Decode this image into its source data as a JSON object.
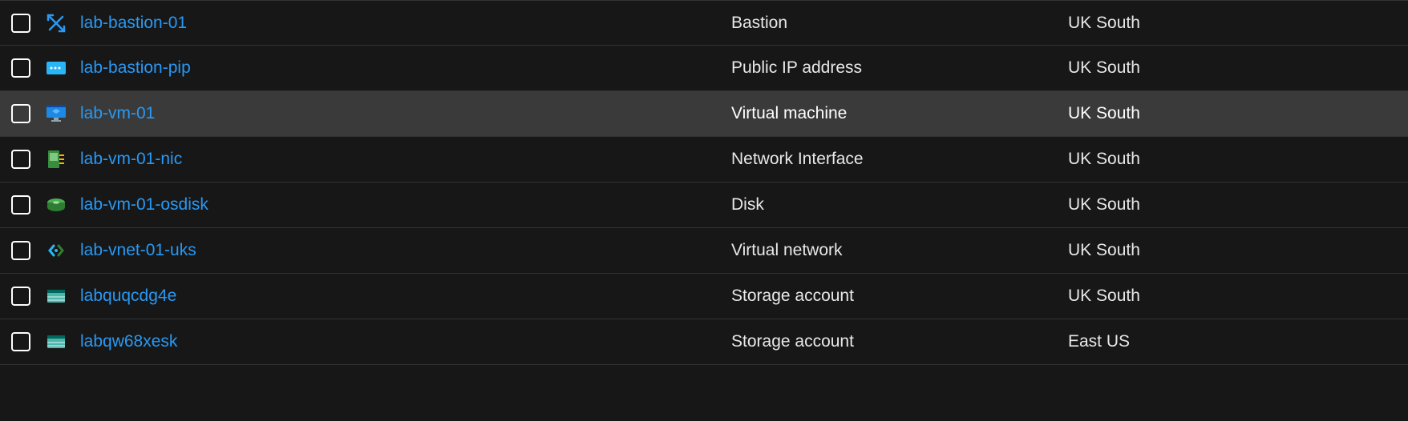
{
  "resources": [
    {
      "name": "lab-bastion-01",
      "type": "Bastion",
      "location": "UK South",
      "icon": "bastion",
      "hover": false
    },
    {
      "name": "lab-bastion-pip",
      "type": "Public IP address",
      "location": "UK South",
      "icon": "pip",
      "hover": false
    },
    {
      "name": "lab-vm-01",
      "type": "Virtual machine",
      "location": "UK South",
      "icon": "vm",
      "hover": true
    },
    {
      "name": "lab-vm-01-nic",
      "type": "Network Interface",
      "location": "UK South",
      "icon": "nic",
      "hover": false
    },
    {
      "name": "lab-vm-01-osdisk",
      "type": "Disk",
      "location": "UK South",
      "icon": "disk",
      "hover": false
    },
    {
      "name": "lab-vnet-01-uks",
      "type": "Virtual network",
      "location": "UK South",
      "icon": "vnet",
      "hover": false
    },
    {
      "name": "labquqcdg4e",
      "type": "Storage account",
      "location": "UK South",
      "icon": "storage",
      "hover": false
    },
    {
      "name": "labqw68xesk",
      "type": "Storage account",
      "location": "East US",
      "icon": "storage",
      "hover": false
    }
  ]
}
